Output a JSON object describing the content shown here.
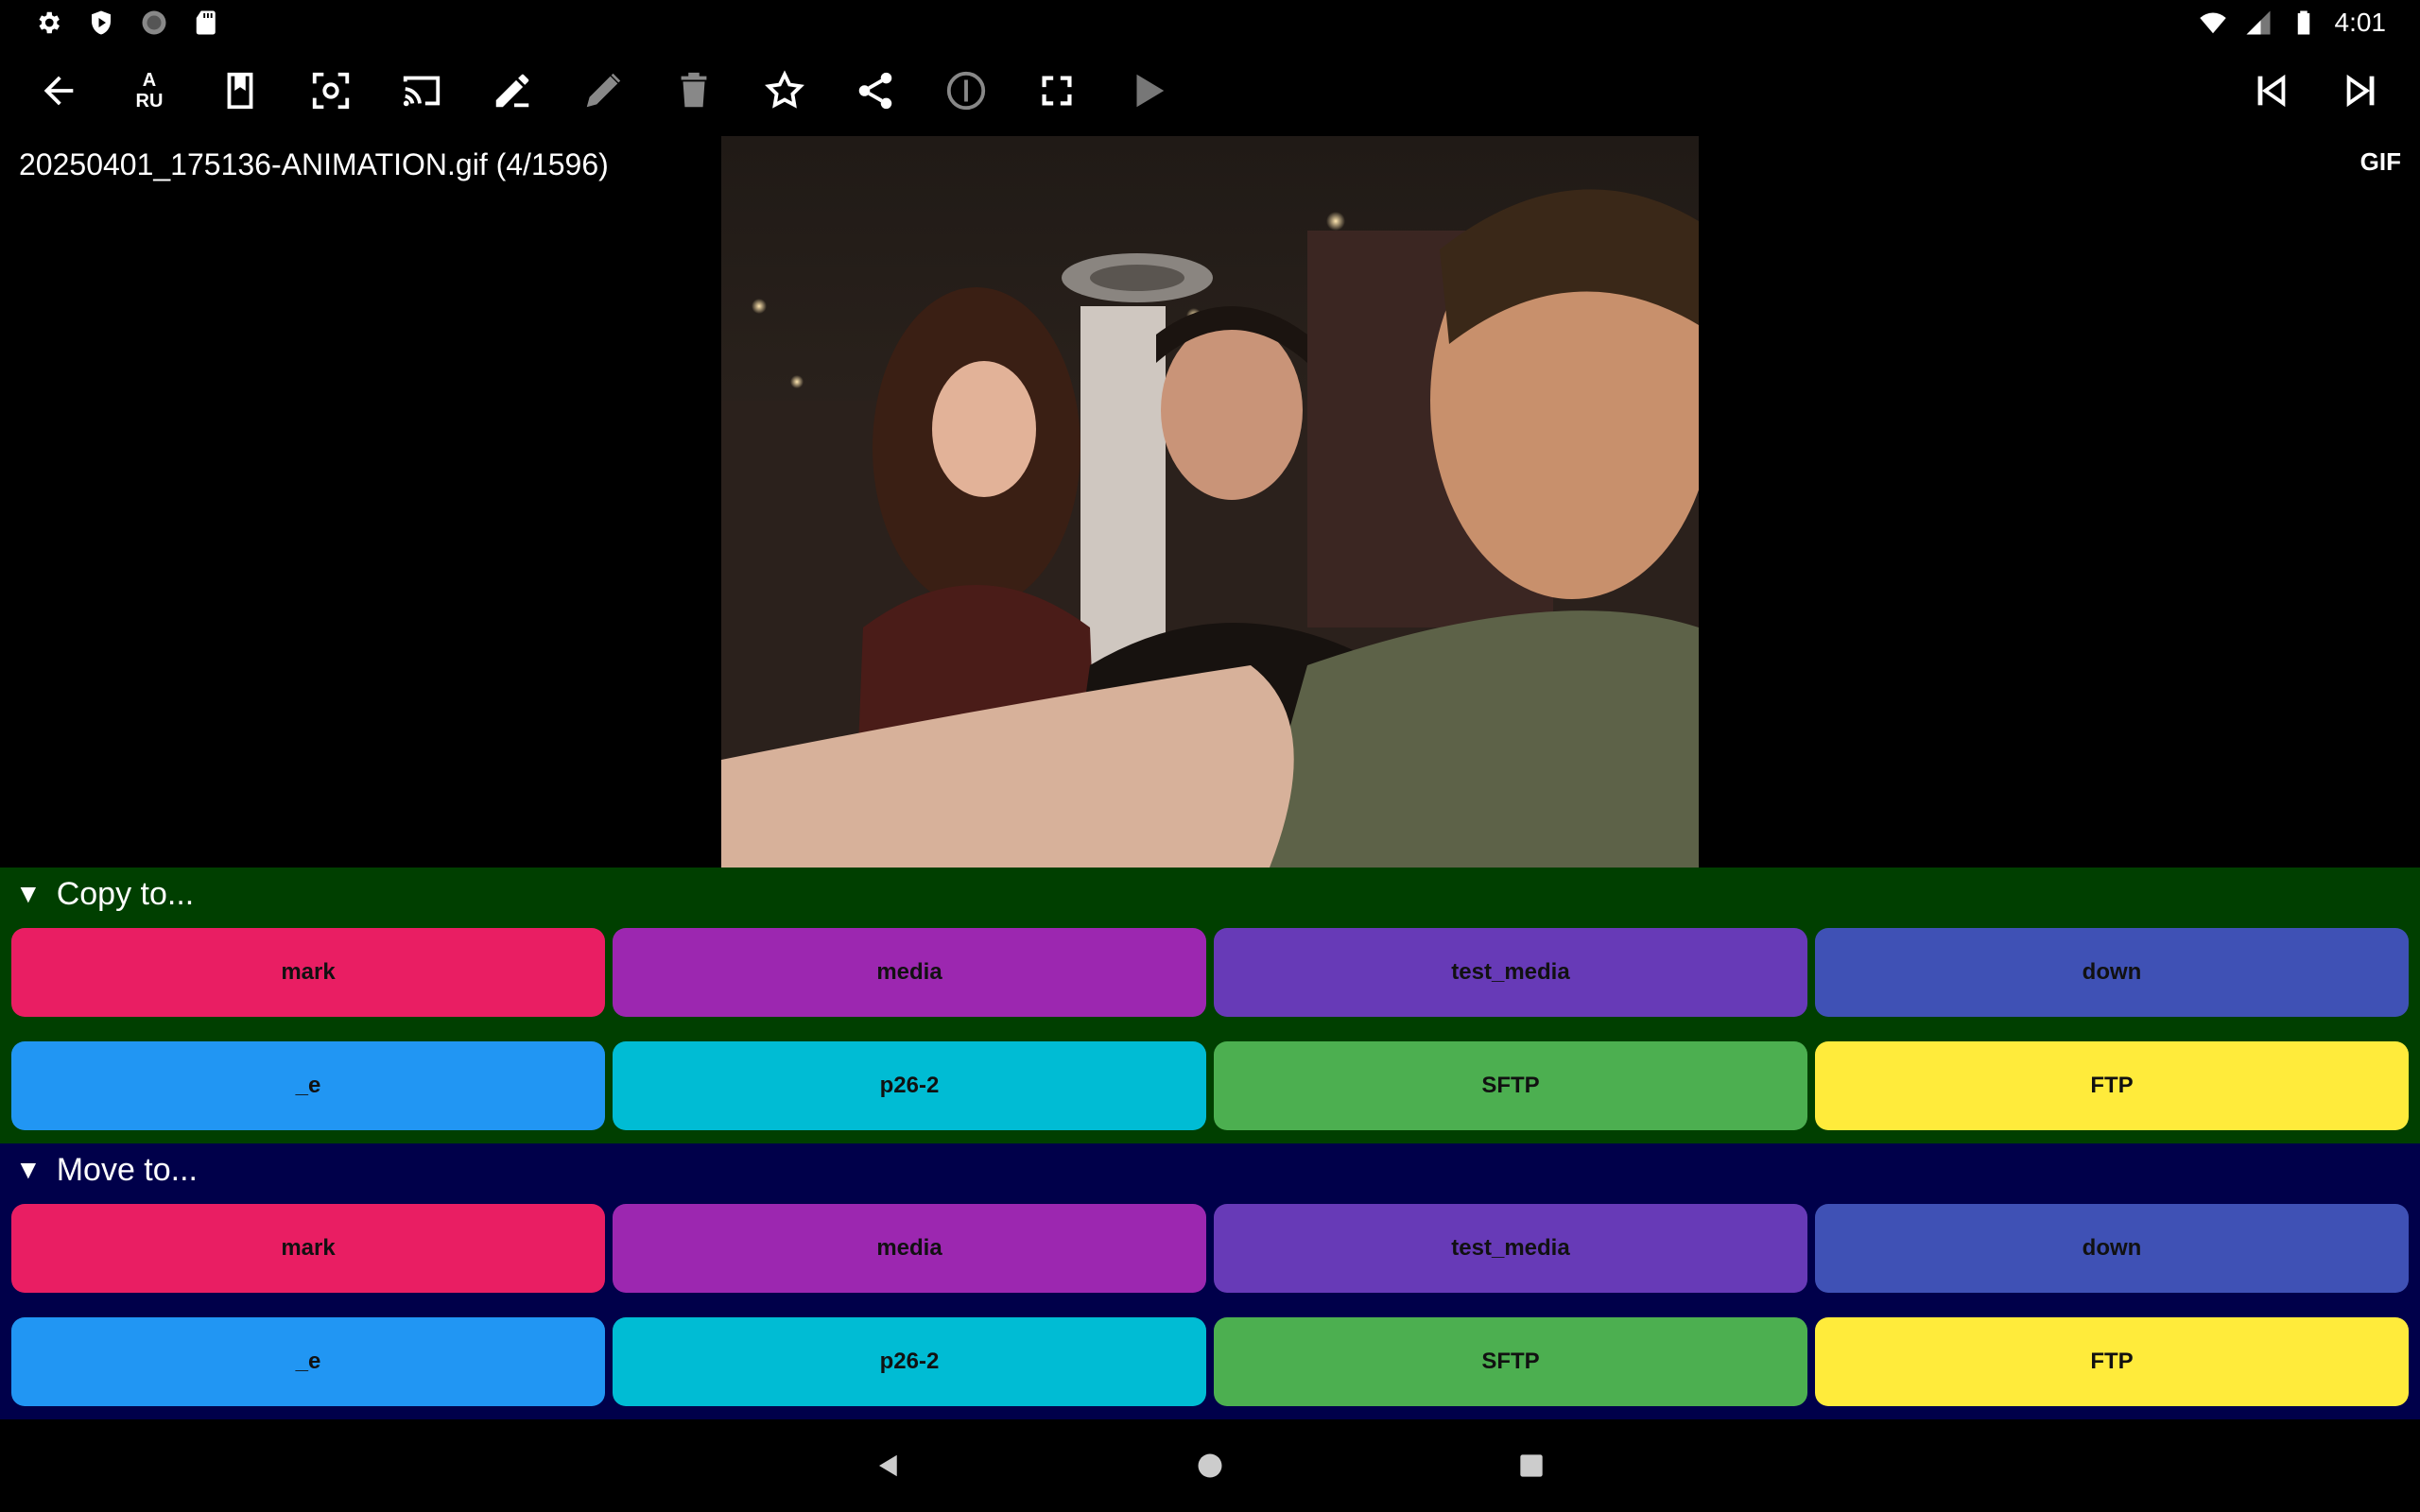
{
  "status_bar": {
    "time": "4:01",
    "icons_left": [
      "gear-icon",
      "shield-play-icon",
      "circle-icon",
      "sd-card-icon"
    ],
    "icons_right": [
      "wifi-icon",
      "signal-icon",
      "battery-icon"
    ]
  },
  "toolbar": {
    "lang_top": "A",
    "lang_bottom": "RU",
    "icons": [
      "back-arrow-icon",
      "translate-icon",
      "bookmark-icon",
      "focus-icon",
      "cast-icon",
      "edit-pencil-icon",
      "pencil-icon",
      "trash-icon",
      "star-icon",
      "share-icon",
      "info-icon",
      "fullscreen-icon",
      "play-icon",
      "skip-previous-icon",
      "skip-next-icon"
    ]
  },
  "file": {
    "title": "20250401_175136-ANIMATION.gif (4/1596)",
    "format": "GIF"
  },
  "copy_panel": {
    "header": "Copy to...",
    "buttons": [
      {
        "label": "mark",
        "color": "#e91e63"
      },
      {
        "label": "media",
        "color": "#9c27b0"
      },
      {
        "label": "test_media",
        "color": "#673ab7"
      },
      {
        "label": "down",
        "color": "#3f51b5"
      },
      {
        "label": "_e",
        "color": "#2196f3"
      },
      {
        "label": "p26-2",
        "color": "#00bcd4"
      },
      {
        "label": "SFTP",
        "color": "#4caf50"
      },
      {
        "label": "FTP",
        "color": "#ffeb3b"
      }
    ]
  },
  "move_panel": {
    "header": "Move to...",
    "buttons": [
      {
        "label": "mark",
        "color": "#e91e63"
      },
      {
        "label": "media",
        "color": "#9c27b0"
      },
      {
        "label": "test_media",
        "color": "#673ab7"
      },
      {
        "label": "down",
        "color": "#3f51b5"
      },
      {
        "label": "_e",
        "color": "#2196f3"
      },
      {
        "label": "p26-2",
        "color": "#00bcd4"
      },
      {
        "label": "SFTP",
        "color": "#4caf50"
      },
      {
        "label": "FTP",
        "color": "#ffeb3b"
      }
    ]
  },
  "colors": {
    "copy_panel_bg": "#003f00",
    "move_panel_bg": "#00004a"
  }
}
